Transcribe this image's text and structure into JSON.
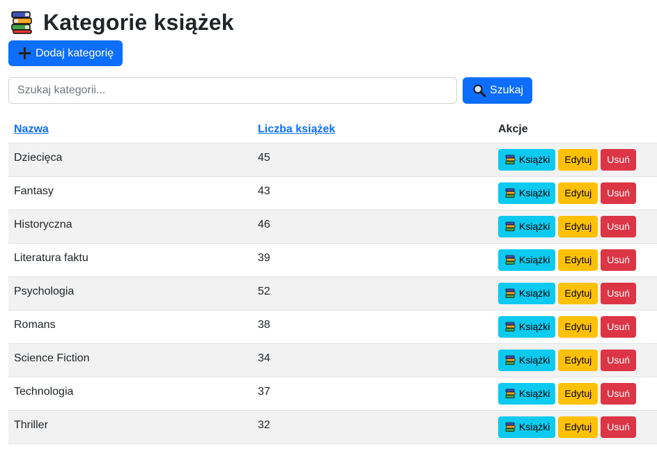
{
  "header": {
    "title": "Kategorie książek",
    "icon": "books-icon"
  },
  "toolbar": {
    "add_label": "Dodaj kategorię",
    "add_icon": "plus-icon"
  },
  "search": {
    "placeholder": "Szukaj kategorii...",
    "value": "",
    "button_label": "Szukaj",
    "button_icon": "magnifier-icon"
  },
  "table": {
    "headers": {
      "name": "Nazwa",
      "count": "Liczba książek",
      "actions": "Akcje"
    },
    "rows": [
      {
        "name": "Dziecięca",
        "count": "45"
      },
      {
        "name": "Fantasy",
        "count": "43"
      },
      {
        "name": "Historyczna",
        "count": "46"
      },
      {
        "name": "Literatura faktu",
        "count": "39"
      },
      {
        "name": "Psychologia",
        "count": "52"
      },
      {
        "name": "Romans",
        "count": "38"
      },
      {
        "name": "Science Fiction",
        "count": "34"
      },
      {
        "name": "Technologia",
        "count": "37"
      },
      {
        "name": "Thriller",
        "count": "32"
      }
    ],
    "action_labels": {
      "books": "Książki",
      "edit": "Edytuj",
      "delete": "Usuń"
    }
  },
  "colors": {
    "primary": "#0d6efd",
    "info": "#0dcaf0",
    "warning": "#ffc107",
    "danger": "#dc3545",
    "stripe": "#f2f2f2"
  }
}
